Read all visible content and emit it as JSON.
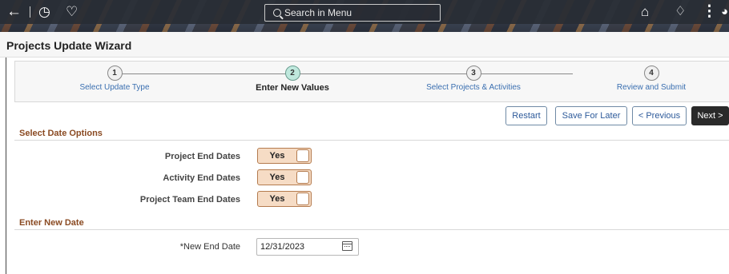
{
  "header": {
    "back_icon": "back-arrow-icon",
    "history_icon": "history-icon",
    "favorites_icon": "heart-icon",
    "search_placeholder": "Search in Menu",
    "home_icon": "home-icon",
    "notifications_icon": "bell-icon",
    "actions_icon": "kebab-menu-icon"
  },
  "page": {
    "title": "Projects Update Wizard"
  },
  "steps": [
    {
      "number": "1",
      "label": "Select Update Type",
      "active": false
    },
    {
      "number": "2",
      "label": "Enter New Values",
      "active": true
    },
    {
      "number": "3",
      "label": "Select Projects & Activities",
      "active": false
    },
    {
      "number": "4",
      "label": "Review and Submit",
      "active": false
    }
  ],
  "toolbar": {
    "restart": "Restart",
    "save_later": "Save For Later",
    "previous": "< Previous",
    "next": "Next >"
  },
  "date_options": {
    "heading": "Select Date Options",
    "rows": [
      {
        "label": "Project End Dates",
        "value": "Yes"
      },
      {
        "label": "Activity End Dates",
        "value": "Yes"
      },
      {
        "label": "Project Team End Dates",
        "value": "Yes"
      }
    ]
  },
  "new_date": {
    "heading": "Enter New Date",
    "label": "*New End Date",
    "value": "12/31/2023",
    "calendar_icon": "calendar-icon"
  },
  "colors": {
    "section_heading": "#8a4a22",
    "toggle_fill": "#f6dcc5",
    "active_step": "#bfe8dd",
    "link": "#3a6fb0"
  }
}
